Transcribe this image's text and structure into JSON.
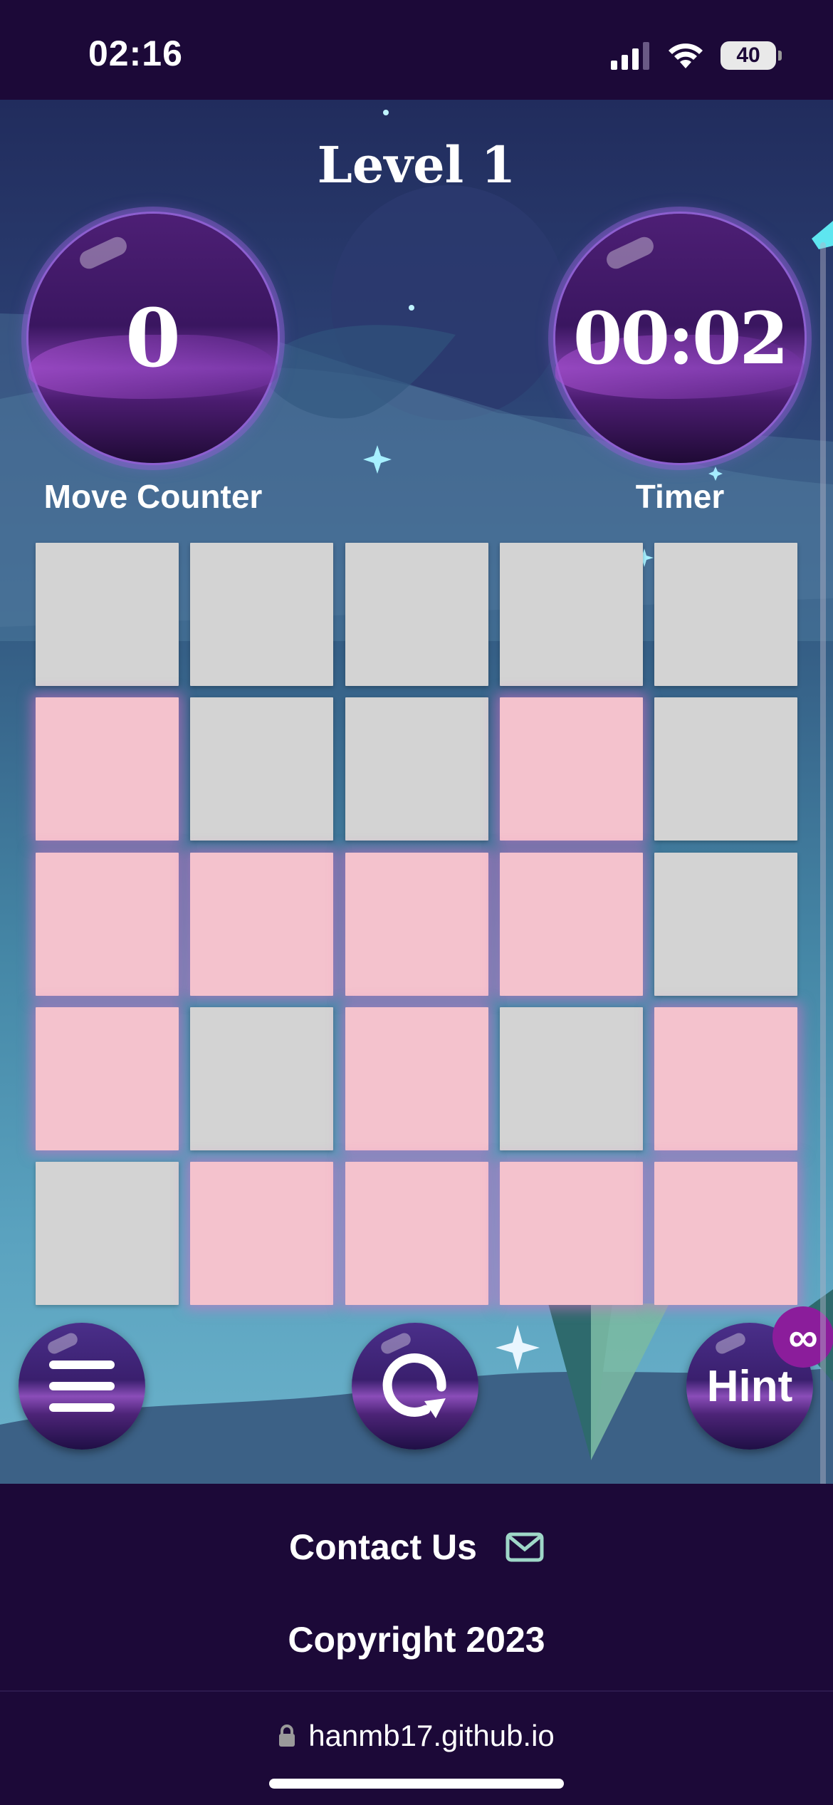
{
  "status_bar": {
    "time": "02:16",
    "battery": "40",
    "icons": [
      "signal-icon",
      "wifi-icon",
      "battery-icon"
    ]
  },
  "game": {
    "level_title": "Level 1",
    "move_counter": {
      "value": "0",
      "label": "Move Counter"
    },
    "timer": {
      "value": "00:02",
      "label": "Timer"
    },
    "board": {
      "rows": 5,
      "cols": 5,
      "cells": [
        [
          0,
          0,
          0,
          0,
          0
        ],
        [
          1,
          0,
          0,
          1,
          0
        ],
        [
          1,
          1,
          1,
          1,
          0
        ],
        [
          1,
          0,
          1,
          0,
          1
        ],
        [
          0,
          1,
          1,
          1,
          1
        ]
      ]
    },
    "controls": {
      "menu_icon": "hamburger-menu-icon",
      "restart_icon": "restart-icon",
      "hint_label": "Hint",
      "hint_badge": "∞"
    },
    "colors": {
      "tile_off": "#d3d3d3",
      "tile_on": "#f4c2cd",
      "background_dark": "#1c0938",
      "orb_accent": "#8d5fd0"
    }
  },
  "footer": {
    "contact_label": "Contact Us",
    "contact_icon": "envelope-icon",
    "copyright": "Copyright 2023"
  },
  "browser": {
    "url": "hanmb17.github.io",
    "lock_icon": "lock-icon"
  }
}
